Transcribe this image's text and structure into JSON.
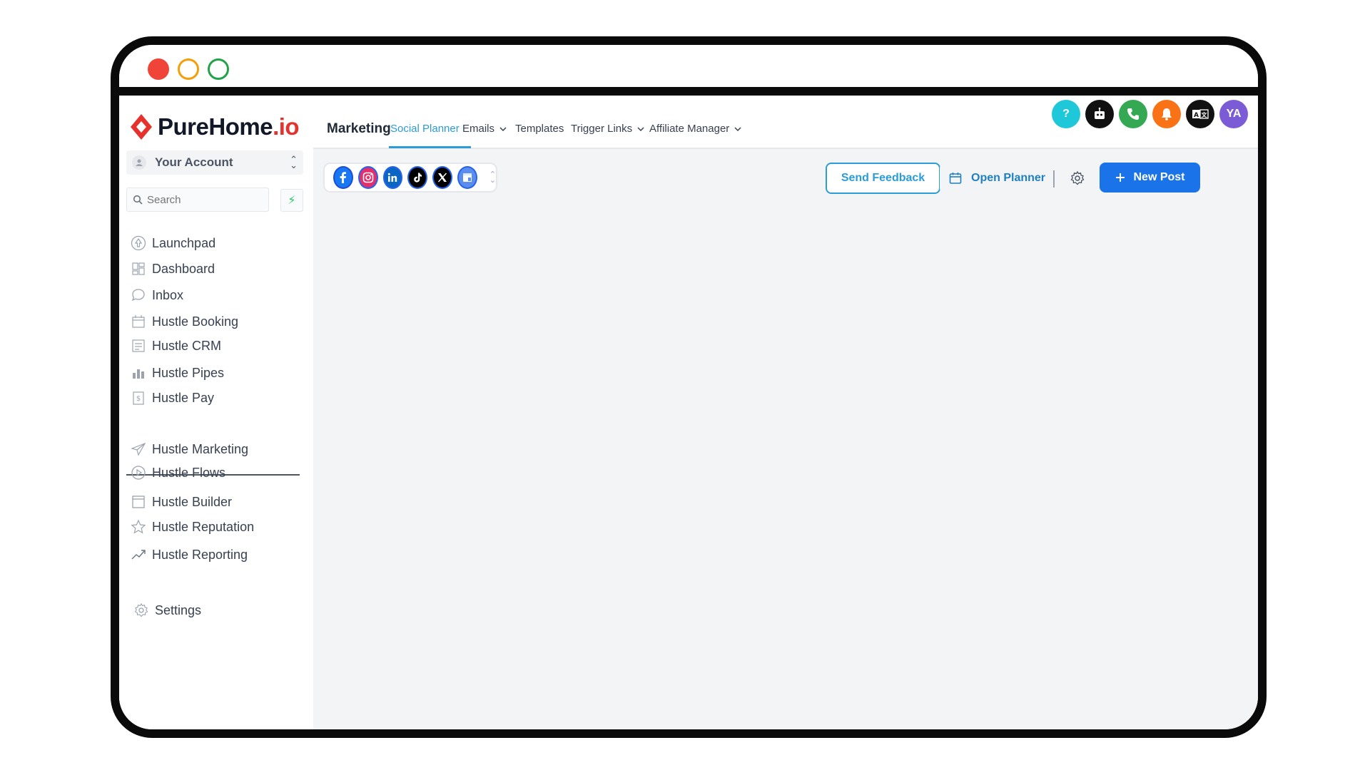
{
  "brand": {
    "name_main": "PureHome",
    "name_suffix": ".io"
  },
  "account": {
    "label": "Your Account"
  },
  "search": {
    "placeholder": "Search"
  },
  "sidebar": {
    "items": [
      {
        "label": "Launchpad",
        "icon": "rocket-icon"
      },
      {
        "label": "Dashboard",
        "icon": "dashboard-icon"
      },
      {
        "label": "Inbox",
        "icon": "chat-bubble-icon"
      },
      {
        "label": "Hustle Booking",
        "icon": "calendar-icon"
      },
      {
        "label": "Hustle CRM",
        "icon": "contacts-list-icon"
      },
      {
        "label": "Hustle Pipes",
        "icon": "pipeline-icon"
      },
      {
        "label": "Hustle Pay",
        "icon": "invoice-icon"
      },
      {
        "label": "Hustle Marketing",
        "icon": "send-icon"
      },
      {
        "label": "Hustle Flows",
        "icon": "play-circle-icon"
      },
      {
        "label": "Hustle Builder",
        "icon": "builder-window-icon"
      },
      {
        "label": "Hustle Reputation",
        "icon": "star-icon"
      },
      {
        "label": "Hustle Reporting",
        "icon": "trend-chart-icon"
      },
      {
        "label": "Settings",
        "icon": "gear-icon"
      }
    ]
  },
  "topnav": {
    "section_title": "Marketing",
    "tabs": [
      {
        "label": "Social Planner",
        "active": true,
        "dropdown": false
      },
      {
        "label": "Emails",
        "active": false,
        "dropdown": true
      },
      {
        "label": "Templates",
        "active": false,
        "dropdown": false
      },
      {
        "label": "Trigger Links",
        "active": false,
        "dropdown": true
      },
      {
        "label": "Affiliate Manager",
        "active": false,
        "dropdown": true
      }
    ],
    "header_icons": [
      {
        "name": "help-icon",
        "color": "#1fc8d8",
        "text": "?"
      },
      {
        "name": "bot-icon",
        "color": "#111111",
        "text": ""
      },
      {
        "name": "phone-icon",
        "color": "#34a853",
        "text": ""
      },
      {
        "name": "bell-icon",
        "color": "#f97316",
        "text": ""
      },
      {
        "name": "translate-icon",
        "color": "#111111",
        "text": ""
      },
      {
        "name": "user-avatar",
        "color": "#7c5cd6",
        "text": "YA"
      }
    ]
  },
  "toolbar": {
    "social_channels": [
      "facebook-icon",
      "instagram-icon",
      "linkedin-icon",
      "tiktok-icon",
      "x-icon",
      "google-business-icon"
    ],
    "send_feedback_label": "Send Feedback",
    "open_planner_label": "Open Planner",
    "new_post_label": "New Post"
  },
  "colors": {
    "accent": "#2b9cd8",
    "primary_button": "#1a73e8",
    "brand_red": "#e5322d"
  }
}
